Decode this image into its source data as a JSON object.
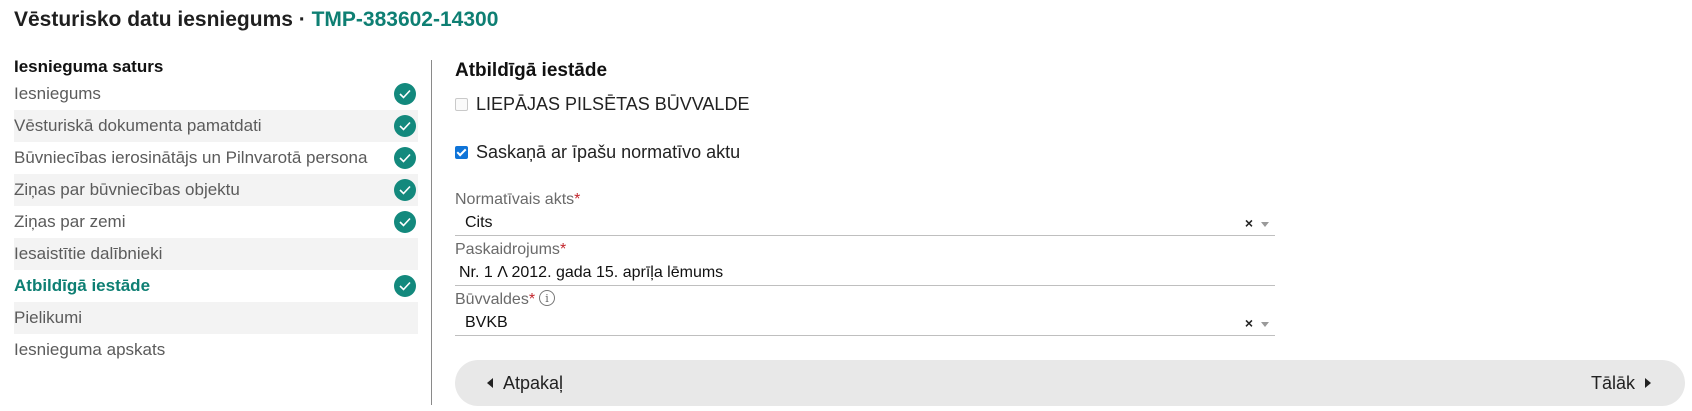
{
  "header": {
    "title": "Vēsturisko datu iesniegums",
    "separator": " · ",
    "code": "TMP-383602-14300"
  },
  "sidebar": {
    "title": "Iesnieguma saturs",
    "items": [
      {
        "label": "Iesniegums",
        "done": true
      },
      {
        "label": "Vēsturiskā dokumenta pamatdati",
        "done": true
      },
      {
        "label": "Būvniecības ierosinātājs un Pilnvarotā persona",
        "done": true
      },
      {
        "label": "Ziņas par būvniecības objektu",
        "done": true
      },
      {
        "label": "Ziņas par zemi",
        "done": true
      },
      {
        "label": "Iesaistītie dalībnieki",
        "done": false
      },
      {
        "label": "Atbildīgā iestāde",
        "done": true,
        "active": true
      },
      {
        "label": "Pielikumi",
        "done": false
      },
      {
        "label": "Iesnieguma apskats",
        "done": false
      }
    ]
  },
  "main": {
    "section_title": "Atbildīgā iestāde",
    "institution_checkbox": {
      "label": "LIEPĀJAS PILSĒTAS BŪVVALDE",
      "checked": false,
      "disabled": true
    },
    "special_act_checkbox": {
      "label": "Saskaņā ar īpašu normatīvo aktu",
      "checked": true
    },
    "normative_act": {
      "label": "Normatīvais akts",
      "required_mark": "*",
      "value": "Cits",
      "clear": "×"
    },
    "explanation": {
      "label": "Paskaidrojums",
      "required_mark": "*",
      "value": "Nr. 1 Λ 2012. gada 15. aprīļa lēmums"
    },
    "building_authorities": {
      "label": "Būvvaldes",
      "required_mark": "*",
      "info": "i",
      "value": "BVKB",
      "clear": "×"
    }
  },
  "nav": {
    "back_label": "Atpakaļ",
    "next_label": "Tālāk"
  },
  "colors": {
    "accent": "#0e7f73",
    "check_bg": "#13897d",
    "required": "#c3262d",
    "checkbox_checked": "#0f74d8"
  }
}
